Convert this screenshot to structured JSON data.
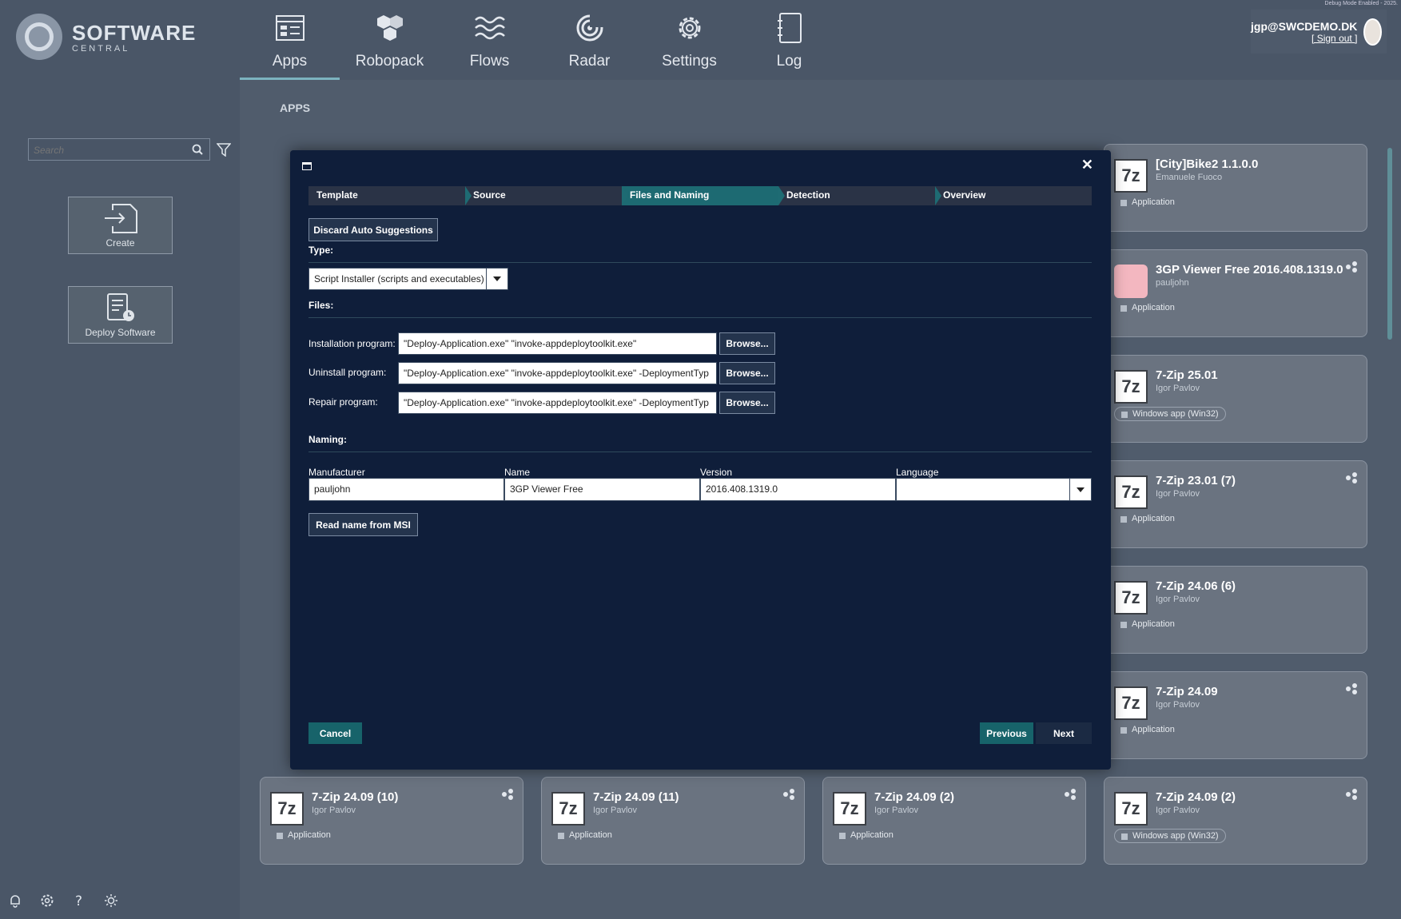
{
  "debug_text": "Debug Mode Enabled - 2025.",
  "logo": {
    "name": "SOFTWARE",
    "sub": "CENTRAL"
  },
  "nav": [
    {
      "label": "Apps",
      "icon": "apps-icon"
    },
    {
      "label": "Robopack",
      "icon": "robopack-icon"
    },
    {
      "label": "Flows",
      "icon": "flows-icon"
    },
    {
      "label": "Radar",
      "icon": "radar-icon"
    },
    {
      "label": "Settings",
      "icon": "gear-icon"
    },
    {
      "label": "Log",
      "icon": "log-icon"
    }
  ],
  "user": {
    "email": "jgp@SWCDEMO.DK",
    "sign_out": "[ Sign out ]"
  },
  "sidebar": {
    "search_placeholder": "Search",
    "create": "Create",
    "deploy": "Deploy Software"
  },
  "main": {
    "title": "APPS"
  },
  "cards": [
    {
      "title": "[City]Bike2 1.1.0.0",
      "sub": "Emanuele Fuoco",
      "badge": "Application",
      "icon": "7z"
    },
    {
      "title": "3GP Viewer Free 2016.408.1319.0",
      "sub": "pauljohn",
      "badge": "Application",
      "icon": "pink"
    },
    {
      "title": "7-Zip 25.01",
      "sub": "Igor Pavlov",
      "badge": "Windows app (Win32)",
      "icon": "7z"
    },
    {
      "title": "7-Zip 23.01 (7)",
      "sub": "Igor Pavlov",
      "badge": "Application",
      "icon": "7z"
    },
    {
      "title": "7-Zip 24.06 (6)",
      "sub": "Igor Pavlov",
      "badge": "Application",
      "icon": "7z"
    },
    {
      "title": "7-Zip 24.09",
      "sub": "Igor Pavlov",
      "badge": "Application",
      "icon": "7z"
    },
    {
      "title": "7-Zip 24.09 (10)",
      "sub": "Igor Pavlov",
      "badge": "Application",
      "icon": "7z"
    },
    {
      "title": "7-Zip 24.09 (11)",
      "sub": "Igor Pavlov",
      "badge": "Application",
      "icon": "7z"
    },
    {
      "title": "7-Zip 24.09 (2)",
      "sub": "Igor Pavlov",
      "badge": "Application",
      "icon": "7z"
    },
    {
      "title": "7-Zip 24.09 (2)",
      "sub": "Igor Pavlov",
      "badge": "Windows app (Win32)",
      "icon": "7z"
    }
  ],
  "dialog": {
    "steps": [
      "Template",
      "Source",
      "Files and Naming",
      "Detection",
      "Overview"
    ],
    "active_step": "Files and Naming",
    "discard_btn": "Discard Auto Suggestions",
    "type_label": "Type:",
    "type_value": "Script Installer (scripts and executables)",
    "files_label": "Files:",
    "install_label": "Installation program:",
    "install_value": "\"Deploy-Application.exe\" \"invoke-appdeploytoolkit.exe\"",
    "uninstall_label": "Uninstall program:",
    "uninstall_value": "\"Deploy-Application.exe\" \"invoke-appdeploytoolkit.exe\" -DeploymentTyp",
    "repair_label": "Repair program:",
    "repair_value": "\"Deploy-Application.exe\" \"invoke-appdeploytoolkit.exe\" -DeploymentTyp",
    "browse": "Browse...",
    "naming_label": "Naming:",
    "manufacturer_label": "Manufacturer",
    "manufacturer_value": "pauljohn",
    "name_label": "Name",
    "name_value": "3GP Viewer Free",
    "version_label": "Version",
    "version_value": "2016.408.1319.0",
    "language_label": "Language",
    "language_value": "",
    "read_msi": "Read name from MSI",
    "cancel": "Cancel",
    "previous": "Previous",
    "next": "Next"
  },
  "colors": {
    "accent": "#1d6a72",
    "dialog_bg": "#0f1e3a",
    "page_bg": "#4a5667"
  }
}
